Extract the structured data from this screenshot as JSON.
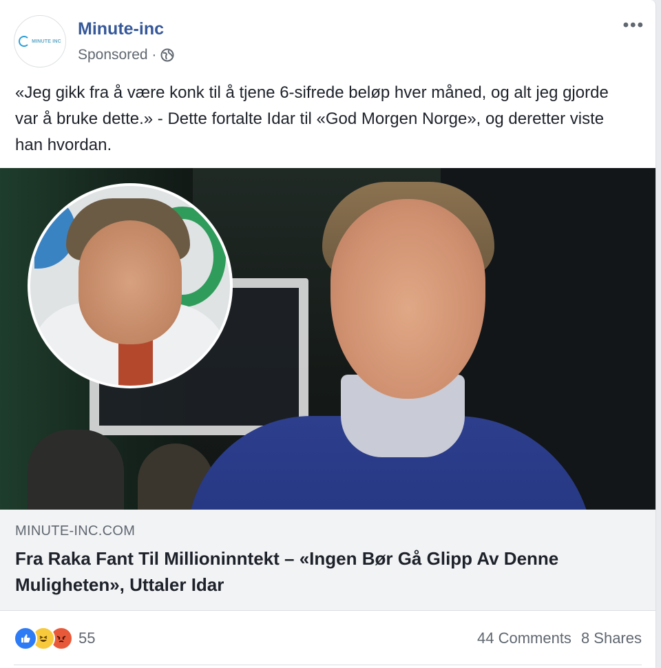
{
  "post": {
    "page_name": "Minute-inc",
    "sponsored": "Sponsored · ",
    "privacy_icon": "globe-icon",
    "more_label": "•••",
    "avatar_logo_text": "MINUTE INC",
    "text": "«Jeg gikk fra å være konk til å tjene 6-sifrede beløp hver måned, og alt jeg gjorde var å bruke dette.» - Dette fortalte Idar til «God Morgen Norge», og deretter viste han hvordan."
  },
  "link": {
    "domain": "MINUTE-INC.COM",
    "headline": "Fra Raka Fant Til Millioninntekt – «Ingen Bør Gå Glipp Av Denne Muligheten», Uttaler Idar"
  },
  "footer": {
    "reaction_icons": [
      "like-icon",
      "haha-icon",
      "angry-icon"
    ],
    "reaction_count": "55",
    "comments": "44 Comments",
    "shares": "8 Shares"
  },
  "colors": {
    "link_blue": "#365899",
    "like_blue": "#2e7bf6",
    "haha_yellow": "#f7c93b",
    "angry_orange": "#e8593a"
  }
}
